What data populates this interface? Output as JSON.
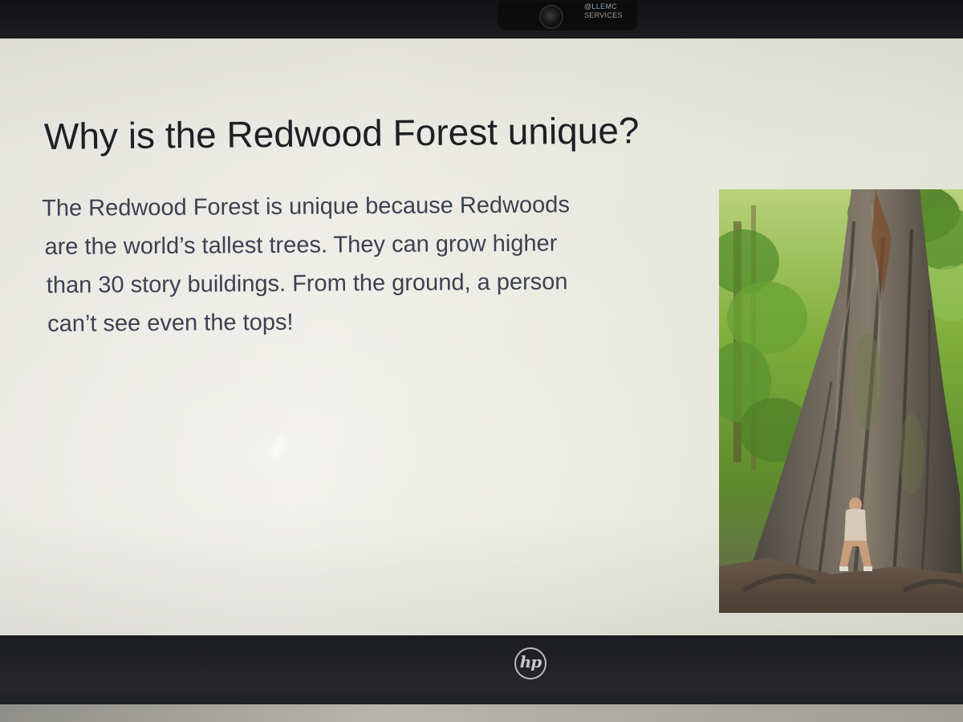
{
  "webcam": {
    "label_line1": "@LLEMC",
    "label_line2": "SERVICES"
  },
  "slide": {
    "title": "Why is the Redwood Forest unique?",
    "body_lines": [
      "The Redwood Forest is unique because Redwoods",
      "are the world’s tallest trees. They can grow higher",
      "than 30 story buildings. From the ground, a person",
      "can’t see even the tops!"
    ]
  },
  "laptop": {
    "brand_logo": "hp"
  },
  "colors": {
    "title_text": "#1e2024",
    "body_text": "#3d4150",
    "slide_bg": "#e8e8e1",
    "bezel": "#1f2023"
  },
  "icons": {
    "laptop_logo": "hp-logo-icon",
    "camera": "webcam-icon"
  }
}
